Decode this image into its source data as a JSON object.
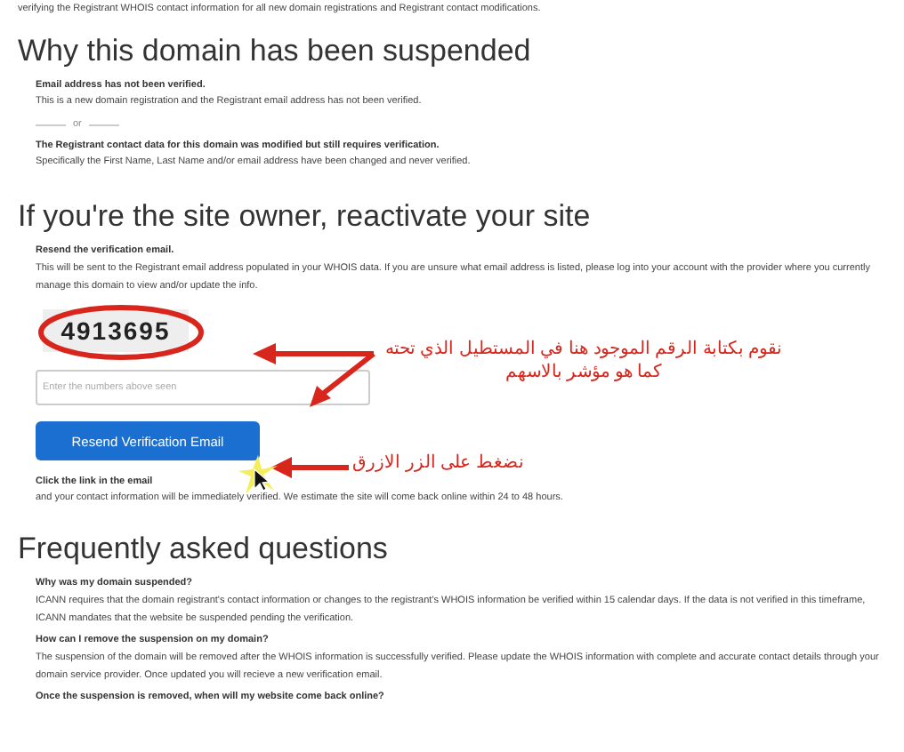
{
  "intro": "verifying the Registrant WHOIS contact information for all new domain registrations and Registrant contact modifications.",
  "suspended": {
    "heading": "Why this domain has been suspended",
    "reasons": [
      {
        "title": "Email address has not been verified.",
        "text": "This is a new domain registration and the Registrant email address has not been verified."
      },
      {
        "title": "The Registrant contact data for this domain was modified but still requires verification.",
        "text": "Specifically the First Name, Last Name and/or email address have been changed and never verified."
      }
    ],
    "separator": "or"
  },
  "reactivate": {
    "heading": "If you're the site owner, reactivate your site",
    "step1_title": "Resend the verification email.",
    "step1_text": "This will be sent to the Registrant email address populated in your WHOIS data. If you are unsure what email address is listed, please log into your account with the provider where you currently manage this domain to view and/or update the info.",
    "captcha": "4913695",
    "input": {
      "placeholder": "Enter the numbers above seen"
    },
    "button": "Resend Verification Email",
    "step2_title": "Click the link in the email",
    "step2_text": "and your contact information will be immediately verified. We estimate the site will come back online within 24 to 48 hours."
  },
  "annotations": [
    "نقوم بكتابة الرقم الموجود هنا في المستطيل الذي تحته",
    "كما هو مؤشر بالاسهم",
    "نضغط على الزر الازرق"
  ],
  "faq": {
    "heading": "Frequently asked questions",
    "items": [
      {
        "question": "Why was my domain suspended?",
        "answer": "ICANN requires that the domain registrant's contact information or changes to the registrant's WHOIS information be verified within 15 calendar days. If the data is not verified in this timeframe, ICANN mandates that the website be suspended pending the verification."
      },
      {
        "question": "How can I remove the suspension on my domain?",
        "answer": "The suspension of the domain will be removed after the WHOIS information is successfully verified. Please update the WHOIS information with complete and accurate contact details through your domain service provider. Once updated you will recieve a new verification email."
      },
      {
        "question": "Once the suspension is removed, when will my website come back online?"
      }
    ]
  }
}
